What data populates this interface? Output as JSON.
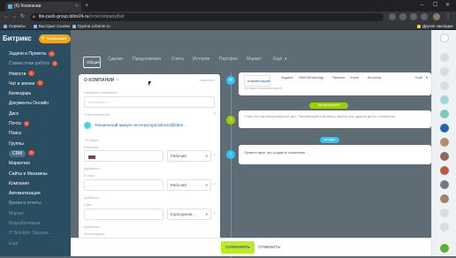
{
  "browser": {
    "tab_title": "(6) Компании",
    "tab_close": "×",
    "new_tab": "+",
    "url_main": "lite-pack-group.bitrix24.ru",
    "url_path": "/crm/company/list/",
    "win_min": "–",
    "win_max": "☐",
    "win_close": "✕",
    "bookmarks": [
      "Сервисы",
      "Быстрые ссылки",
      "Группа 1cbonm.ru"
    ],
    "other_bookmarks": "Другие закладки"
  },
  "sidebar": {
    "logo": "Битрикс",
    "logo_num": "24",
    "add_company": "Компания",
    "items": [
      {
        "label": "Задачи и Проекты",
        "badge": "4"
      },
      {
        "label": "Совместная работа",
        "badge": "3"
      },
      {
        "label": "Новости",
        "badge": "1"
      },
      {
        "label": "Чат и звонки",
        "badge": "4"
      },
      {
        "label": "Календарь",
        "badge": ""
      },
      {
        "label": "Документы Онлайн",
        "badge": ""
      },
      {
        "label": "Диск",
        "badge": ""
      },
      {
        "label": "Почта",
        "badge": "1"
      },
      {
        "label": "Поиск",
        "badge": ""
      },
      {
        "label": "Группы",
        "badge": ""
      },
      {
        "label": "CRM",
        "badge": "3"
      },
      {
        "label": "Маркетинг",
        "badge": ""
      },
      {
        "label": "Сайты и Магазины",
        "badge": ""
      },
      {
        "label": "Компания",
        "badge": ""
      },
      {
        "label": "Автоматизация",
        "badge": ""
      },
      {
        "label": "Время и отчеты",
        "badge": ""
      },
      {
        "label": "Маркет",
        "badge": ""
      },
      {
        "label": "Разработчикам",
        "badge": ""
      },
      {
        "label": "IT Solution: Загрузк…",
        "badge": ""
      },
      {
        "label": "Ещё",
        "badge": ""
      }
    ]
  },
  "main_tabs": [
    "Общие",
    "Сделки",
    "Предложения",
    "Счета",
    "История",
    "Портфел",
    "Маркет",
    "Ещё"
  ],
  "form": {
    "header": "О КОМПАНИИ",
    "cancel": "отменить",
    "name_label": "Название компании*",
    "name_placeholder": "Компания #",
    "section2_label": "Ответственный",
    "tech_account": "Технический аккаунт интегратора bitrix24@bitrix…",
    "phone_label": "Телефон",
    "phone_sub": "Рабочий",
    "phone_type": "Рабочий",
    "add1": "Добавить",
    "email_label": "E-mail",
    "email_type": "Рабочий",
    "add2": "Добавить",
    "site_label": "Сайт",
    "site_type": "Корпоратив…",
    "add3": "Добавить",
    "messenger_label": "Мессенджер"
  },
  "timeline": {
    "tabs": [
      "Комментарий",
      "Задача",
      "SMS/WhatsApp",
      "Письмо",
      "Zoom",
      "Встреча",
      "Ещё"
    ],
    "comment_placeholder": "Оставьте комментарий",
    "pill_planned": "Запланировано",
    "planned_text": "У вас нет запланированных дел. Запланируйте встречу, звонок или другое дело с клиентом.",
    "pill_today": "сегодня",
    "today_text": "Приветствую, вы создаёте компанию…"
  },
  "footer": {
    "save": "СОХРАНИТЬ",
    "cancel": "ОТМЕНИТЬ"
  },
  "colors": {
    "sidebar_bg": "#2a4d61",
    "accent_orange": "#f7a700",
    "save_green": "#bbed21",
    "link_blue": "#2067b0",
    "badge_red": "#f0522e"
  }
}
